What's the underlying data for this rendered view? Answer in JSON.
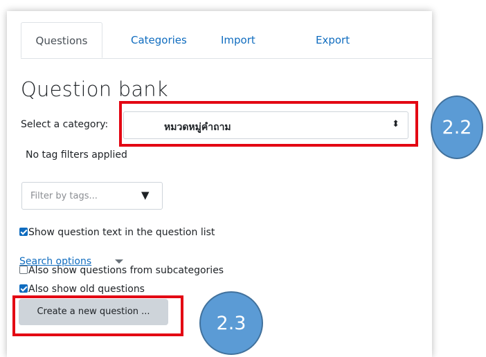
{
  "tabs": [
    {
      "label": "Questions",
      "active": true
    },
    {
      "label": "Categories",
      "active": false
    },
    {
      "label": "Import",
      "active": false
    },
    {
      "label": "Export",
      "active": false
    }
  ],
  "page_title": "Question bank",
  "category": {
    "label": "Select a category:",
    "selected": "หมวดหมู่คำถาม",
    "arrow_icon": "updown-caret-icon"
  },
  "tag_status": "No tag filters applied",
  "tag_filter": {
    "placeholder": "Filter by tags...",
    "arrow_icon": "triangle-down-icon"
  },
  "options": {
    "show_question_text": {
      "label": "Show question text in the question list",
      "checked": true
    },
    "search_options": "Search options",
    "show_subcategories": {
      "label": "Also show questions from subcategories",
      "checked": false
    },
    "show_old": {
      "label": "Also show old questions",
      "checked": true
    }
  },
  "create_button": "Create a new question ...",
  "annotations": [
    {
      "label": "2.2"
    },
    {
      "label": "2.3"
    }
  ],
  "colors": {
    "link": "#0f6cbf",
    "annotation_red": "#e30613",
    "callout_blue": "#5b9bd5"
  }
}
